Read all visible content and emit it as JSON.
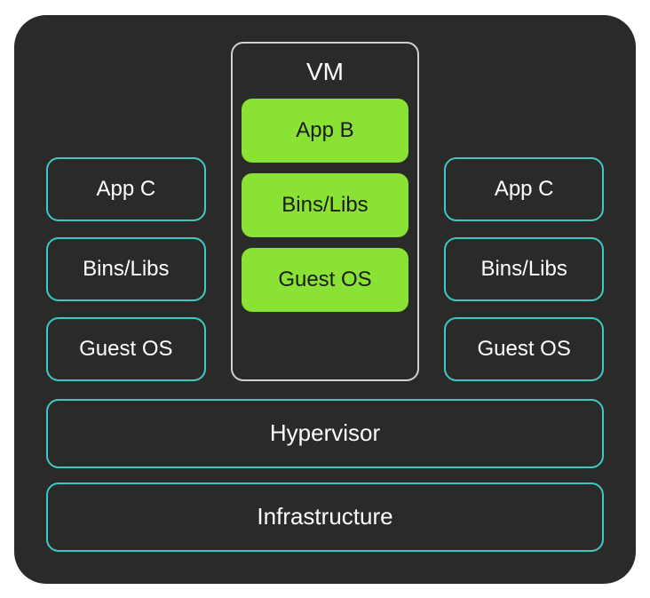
{
  "diagram": {
    "vm_title": "VM",
    "left_col": {
      "app": "App C",
      "bins": "Bins/Libs",
      "os": "Guest OS"
    },
    "center_col": {
      "app": "App B",
      "bins": "Bins/Libs",
      "os": "Guest OS"
    },
    "right_col": {
      "app": "App C",
      "bins": "Bins/Libs",
      "os": "Guest OS"
    },
    "hypervisor": "Hypervisor",
    "infrastructure": "Infrastructure"
  },
  "colors": {
    "background": "#2a2a28",
    "border_teal": "#3ec9c9",
    "highlight_green": "#8ae234",
    "text_light": "#ffffff",
    "text_dark": "#1a1a1a"
  }
}
